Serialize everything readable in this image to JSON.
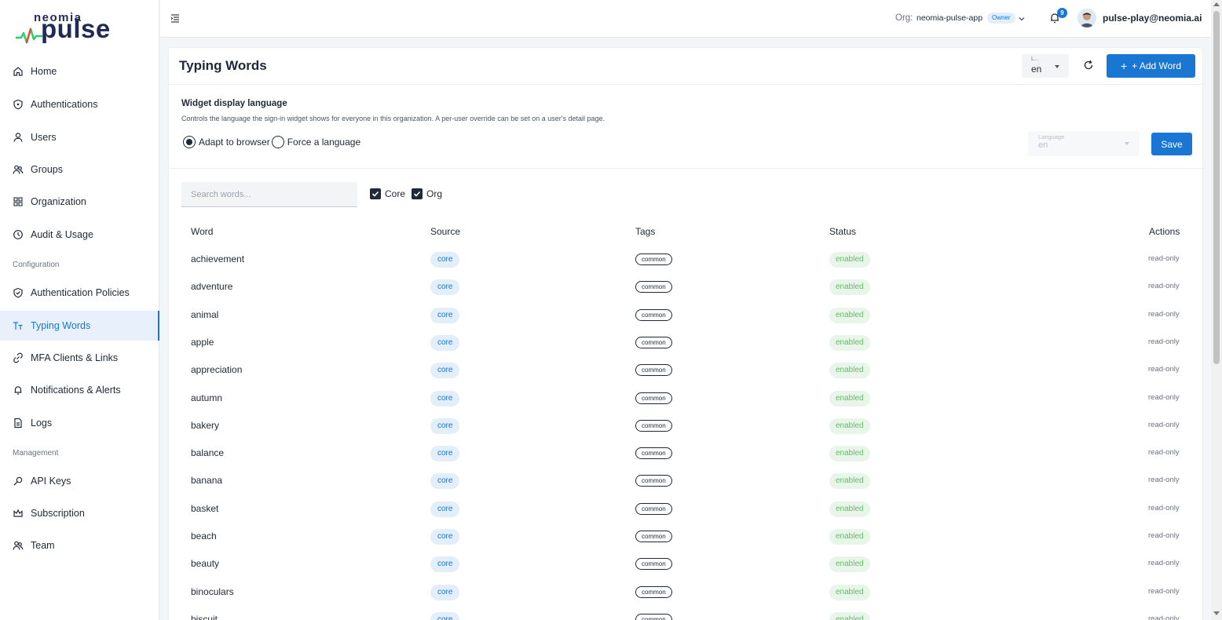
{
  "brand": {
    "top": "neomia",
    "main": "pulse"
  },
  "nav": {
    "items": [
      {
        "label": "Home",
        "icon": "home-icon"
      },
      {
        "label": "Authentications",
        "icon": "shield-lock-icon"
      },
      {
        "label": "Users",
        "icon": "user-icon"
      },
      {
        "label": "Groups",
        "icon": "users-icon"
      },
      {
        "label": "Organization",
        "icon": "grid-icon"
      },
      {
        "label": "Audit & Usage",
        "icon": "clock-icon"
      },
      {
        "label": "Authentication Policies",
        "icon": "shield-check-icon"
      },
      {
        "label": "Typing Words",
        "icon": "text-size-icon"
      },
      {
        "label": "MFA Clients & Links",
        "icon": "link-icon"
      },
      {
        "label": "Notifications & Alerts",
        "icon": "bell-icon"
      },
      {
        "label": "Logs",
        "icon": "file-icon"
      },
      {
        "label": "API Keys",
        "icon": "key-icon"
      },
      {
        "label": "Subscription",
        "icon": "crown-icon"
      },
      {
        "label": "Team",
        "icon": "team-icon"
      }
    ],
    "sections": {
      "configuration": "Configuration",
      "management": "Management"
    },
    "active": "Typing Words"
  },
  "topbar": {
    "org_label": "Org:",
    "org_name": "neomia-pulse-app",
    "role_badge": "Owner",
    "notification_count": "9",
    "user_email": "pulse-play@neomia.ai"
  },
  "page": {
    "title": "Typing Words",
    "language_select": {
      "label": "L...",
      "value": "en"
    },
    "add_button": "+ Add Word"
  },
  "widget_settings": {
    "title": "Widget display language",
    "description": "Controls the language the sign-in widget shows for everyone in this organization. A per-user override can be set on a user's detail page.",
    "option_browser": "Adapt to browser",
    "option_force": "Force a language",
    "selected_option": "Adapt to browser",
    "language_field": {
      "label": "Language",
      "value": "en"
    },
    "save_button": "Save"
  },
  "filters": {
    "search_placeholder": "Search words...",
    "search_value": "",
    "core_label": "Core",
    "core_checked": true,
    "org_label": "Org",
    "org_checked": true
  },
  "table": {
    "columns": [
      "Word",
      "Source",
      "Tags",
      "Status",
      "Actions"
    ],
    "rows": [
      {
        "word": "achievement",
        "source": "core",
        "tag": "common",
        "status": "enabled",
        "action": "read-only"
      },
      {
        "word": "adventure",
        "source": "core",
        "tag": "common",
        "status": "enabled",
        "action": "read-only"
      },
      {
        "word": "animal",
        "source": "core",
        "tag": "common",
        "status": "enabled",
        "action": "read-only"
      },
      {
        "word": "apple",
        "source": "core",
        "tag": "common",
        "status": "enabled",
        "action": "read-only"
      },
      {
        "word": "appreciation",
        "source": "core",
        "tag": "common",
        "status": "enabled",
        "action": "read-only"
      },
      {
        "word": "autumn",
        "source": "core",
        "tag": "common",
        "status": "enabled",
        "action": "read-only"
      },
      {
        "word": "bakery",
        "source": "core",
        "tag": "common",
        "status": "enabled",
        "action": "read-only"
      },
      {
        "word": "balance",
        "source": "core",
        "tag": "common",
        "status": "enabled",
        "action": "read-only"
      },
      {
        "word": "banana",
        "source": "core",
        "tag": "common",
        "status": "enabled",
        "action": "read-only"
      },
      {
        "word": "basket",
        "source": "core",
        "tag": "common",
        "status": "enabled",
        "action": "read-only"
      },
      {
        "word": "beach",
        "source": "core",
        "tag": "common",
        "status": "enabled",
        "action": "read-only"
      },
      {
        "word": "beauty",
        "source": "core",
        "tag": "common",
        "status": "enabled",
        "action": "read-only"
      },
      {
        "word": "binoculars",
        "source": "core",
        "tag": "common",
        "status": "enabled",
        "action": "read-only"
      },
      {
        "word": "biscuit",
        "source": "core",
        "tag": "common",
        "status": "enabled",
        "action": "read-only"
      }
    ]
  },
  "colors": {
    "accent": "#1976d2",
    "status_green": "#66bb6a"
  }
}
